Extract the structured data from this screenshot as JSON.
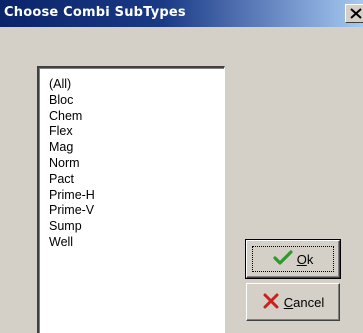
{
  "window": {
    "title": "Choose Combi SubTypes",
    "close_glyph": "close-icon"
  },
  "list": {
    "items": [
      "(All)",
      "Bloc",
      "Chem",
      "Flex",
      "Mag",
      "Norm",
      "Pact",
      "Prime-H",
      "Prime-V",
      "Sump",
      "Well"
    ]
  },
  "buttons": {
    "ok": {
      "mnemonic": "O",
      "rest": "k",
      "icon": "checkmark-icon",
      "icon_color": "#2e9a2e"
    },
    "cancel": {
      "mnemonic": "C",
      "rest": "ancel",
      "icon": "cross-icon",
      "icon_color": "#cc1f1f"
    }
  },
  "colors": {
    "titlebar_start": "#0a246a",
    "titlebar_end": "#a6caf0",
    "face": "#d4d0c8"
  }
}
